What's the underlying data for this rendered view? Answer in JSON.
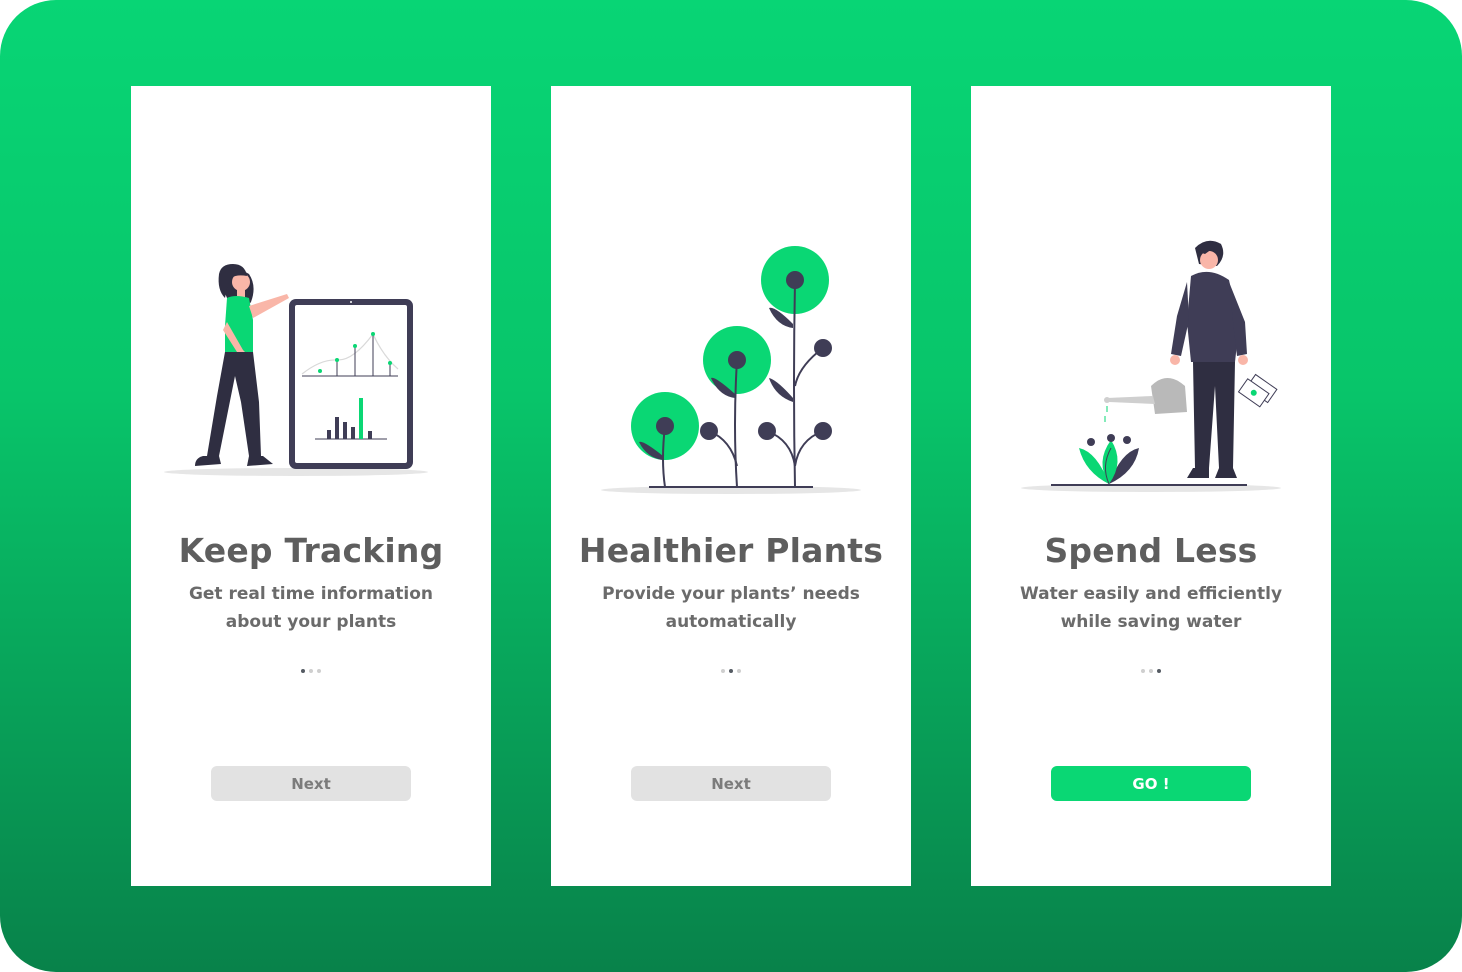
{
  "colors": {
    "accent": "#0AD774",
    "background_top": "#08D575",
    "background_bottom": "#08824A",
    "text": "#5E5E5E",
    "dark_ink": "#3F3D56"
  },
  "screens": [
    {
      "title": "Keep Tracking",
      "subtitle_line1": "Get real time information",
      "subtitle_line2": "about your plants",
      "active_dot": 0,
      "button_label": "Next",
      "illustration": "woman-tablet-chart-illustration"
    },
    {
      "title": "Healthier Plants",
      "subtitle_line1": "Provide your plants’ needs",
      "subtitle_line2": "automatically",
      "active_dot": 1,
      "button_label": "Next",
      "illustration": "plants-growing-illustration"
    },
    {
      "title": "Spend Less",
      "subtitle_line1": "Water easily and  efficiently",
      "subtitle_line2": "while saving water",
      "active_dot": 2,
      "button_label": "GO !",
      "illustration": "man-watering-plant-illustration"
    }
  ]
}
